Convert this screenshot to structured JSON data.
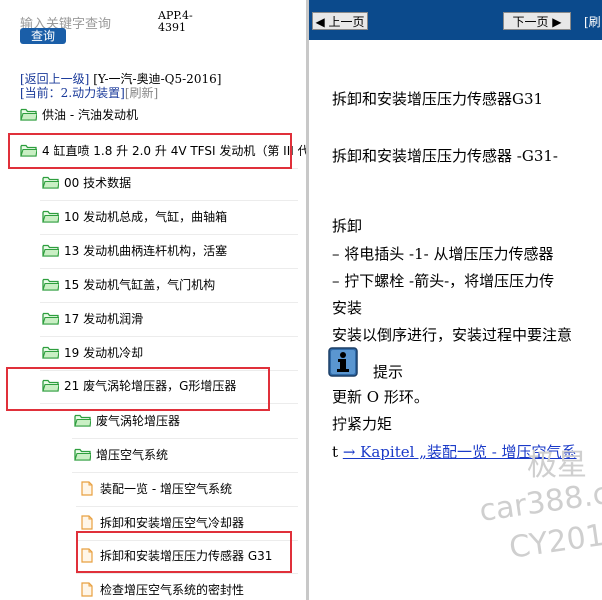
{
  "search": {
    "placeholder": "输入关键字查询",
    "button": "查询"
  },
  "app_version": "APP.4-4391",
  "nav": {
    "back": "[返回上一级]",
    "path": "[Y-一汽-奥迪-Q5-2016]",
    "current_prefix": "[当前：2.动力装置]",
    "refresh": "[刷新]"
  },
  "tree": [
    {
      "label": "供油 - 汽油发动机",
      "icon": "folder-icon"
    },
    {
      "label": "4 缸直喷 1.8 升 2.0 升 4V TFSI 发动机（第 III 代",
      "icon": "folder-icon"
    },
    {
      "label": "00 技术数据",
      "icon": "folder-icon"
    },
    {
      "label": "10 发动机总成，气缸，曲轴箱",
      "icon": "folder-icon"
    },
    {
      "label": "13 发动机曲柄连杆机构，活塞",
      "icon": "folder-icon"
    },
    {
      "label": "15 发动机气缸盖，气门机构",
      "icon": "folder-icon"
    },
    {
      "label": "17 发动机润滑",
      "icon": "folder-icon"
    },
    {
      "label": "19 发动机冷却",
      "icon": "folder-icon"
    },
    {
      "label": "21 废气涡轮增压器，G形增压器",
      "icon": "folder-icon"
    },
    {
      "label": "废气涡轮增压器",
      "icon": "folder-icon"
    },
    {
      "label": "增压空气系统",
      "icon": "folder-icon"
    },
    {
      "label": "装配一览 - 增压空气系统",
      "icon": "document-icon"
    },
    {
      "label": "拆卸和安装增压空气冷却器",
      "icon": "document-icon"
    },
    {
      "label": "拆卸和安装增压压力传感器 G31",
      "icon": "document-icon"
    },
    {
      "label": "检查增压空气系统的密封性",
      "icon": "document-icon"
    }
  ],
  "pager": {
    "prev": "上一页",
    "next": "下一页",
    "refresh": "[刷"
  },
  "doc": {
    "title": "拆卸和安装增压压力传感器G31",
    "subtitle": "拆卸和安装增压压力传感器 -G31-",
    "remove_heading": "拆卸",
    "step1": "–  将电插头 -1- 从增压压力传感器",
    "step2": "–  拧下螺栓 -箭头-，将增压压力传",
    "install_heading": "安装",
    "install_text": "安装以倒序进行，安装过程中要注意",
    "hint_label": "提示",
    "replace_text": "更新  O 形环。",
    "torque_heading": "拧紧力矩",
    "link_prefix": "t",
    "link_text": "→ Kapitel „装配一览 - 增压空气系"
  },
  "watermark": [
    "极星",
    "car388.c",
    "CY2010"
  ],
  "colors": {
    "topbar": "#0b4a8c",
    "highlight": "#e0303a",
    "folder": "#2e9e3e",
    "doc_icon": "#e8a040",
    "link": "#1a3ac8"
  }
}
